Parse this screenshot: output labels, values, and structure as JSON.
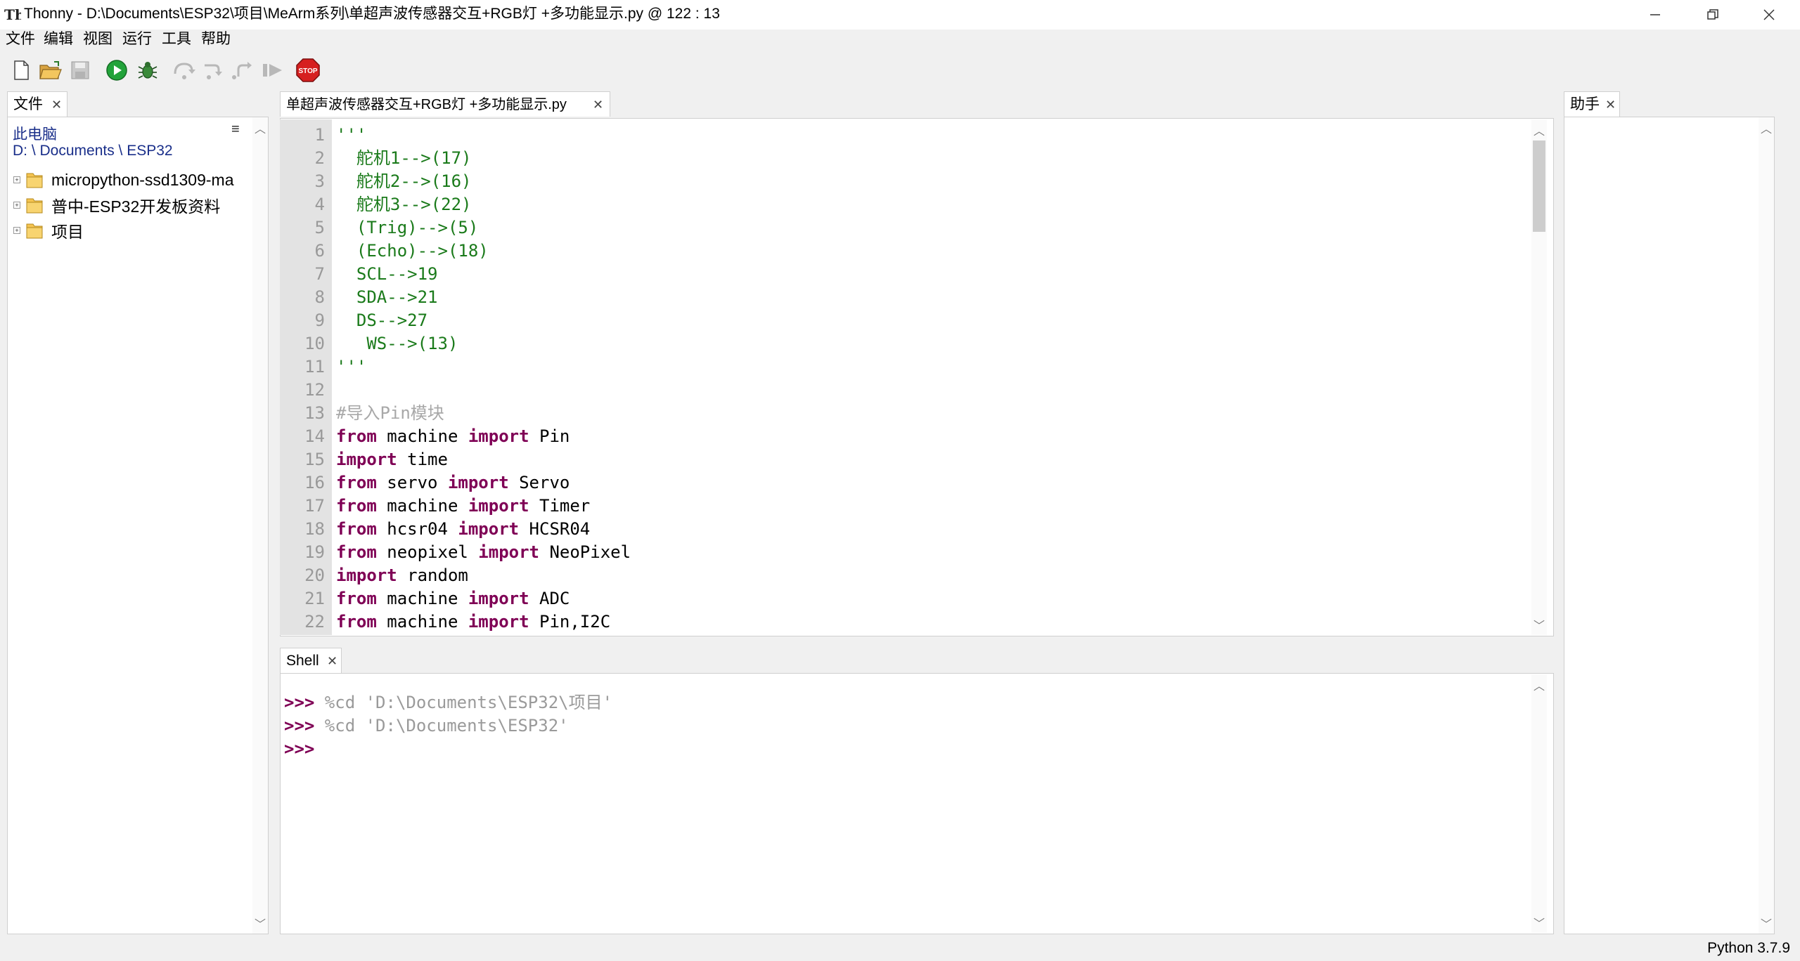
{
  "window": {
    "app_name": "Thonny",
    "title": "Thonny  -  D:\\Documents\\ESP32\\项目\\MeArm系列\\单超声波传感器交互+RGB灯 +多功能显示.py  @  122 : 13"
  },
  "menu": [
    "文件",
    "编辑",
    "视图",
    "运行",
    "工具",
    "帮助"
  ],
  "files_panel": {
    "tab": "文件",
    "location_label": "此电脑",
    "path": "D: \\ Documents \\ ESP32",
    "menu_glyph": "≡",
    "items": [
      {
        "label": "micropython-ssd1309-ma"
      },
      {
        "label": "普中-ESP32开发板资料"
      },
      {
        "label": "项目"
      }
    ]
  },
  "editor": {
    "tab": "单超声波传感器交互+RGB灯 +多功能显示.py",
    "lines": [
      {
        "n": "1",
        "parts": [
          {
            "t": "'''",
            "c": "str"
          }
        ]
      },
      {
        "n": "2",
        "parts": [
          {
            "t": "  舵机1-->(17)",
            "c": "str"
          }
        ]
      },
      {
        "n": "3",
        "parts": [
          {
            "t": "  舵机2-->(16)",
            "c": "str"
          }
        ]
      },
      {
        "n": "4",
        "parts": [
          {
            "t": "  舵机3-->(22)",
            "c": "str"
          }
        ]
      },
      {
        "n": "5",
        "parts": [
          {
            "t": "  (Trig)-->(5)",
            "c": "str"
          }
        ]
      },
      {
        "n": "6",
        "parts": [
          {
            "t": "  (Echo)-->(18)",
            "c": "str"
          }
        ]
      },
      {
        "n": "7",
        "parts": [
          {
            "t": "  SCL-->19",
            "c": "str"
          }
        ]
      },
      {
        "n": "8",
        "parts": [
          {
            "t": "  SDA-->21",
            "c": "str"
          }
        ]
      },
      {
        "n": "9",
        "parts": [
          {
            "t": "  DS-->27",
            "c": "str"
          }
        ]
      },
      {
        "n": "10",
        "parts": [
          {
            "t": "   WS-->(13)",
            "c": "str"
          }
        ]
      },
      {
        "n": "11",
        "parts": [
          {
            "t": "'''",
            "c": "str"
          }
        ]
      },
      {
        "n": "12",
        "parts": []
      },
      {
        "n": "13",
        "parts": [
          {
            "t": "#导入Pin模块",
            "c": "cmt"
          }
        ]
      },
      {
        "n": "14",
        "parts": [
          {
            "t": "from",
            "c": "kw"
          },
          {
            "t": " machine ",
            "c": ""
          },
          {
            "t": "import",
            "c": "kw"
          },
          {
            "t": " Pin",
            "c": ""
          }
        ]
      },
      {
        "n": "15",
        "parts": [
          {
            "t": "import",
            "c": "kw"
          },
          {
            "t": " time",
            "c": ""
          }
        ]
      },
      {
        "n": "16",
        "parts": [
          {
            "t": "from",
            "c": "kw"
          },
          {
            "t": " servo ",
            "c": ""
          },
          {
            "t": "import",
            "c": "kw"
          },
          {
            "t": " Servo",
            "c": ""
          }
        ]
      },
      {
        "n": "17",
        "parts": [
          {
            "t": "from",
            "c": "kw"
          },
          {
            "t": " machine ",
            "c": ""
          },
          {
            "t": "import",
            "c": "kw"
          },
          {
            "t": " Timer",
            "c": ""
          }
        ]
      },
      {
        "n": "18",
        "parts": [
          {
            "t": "from",
            "c": "kw"
          },
          {
            "t": " hcsr04 ",
            "c": ""
          },
          {
            "t": "import",
            "c": "kw"
          },
          {
            "t": " HCSR04",
            "c": ""
          }
        ]
      },
      {
        "n": "19",
        "parts": [
          {
            "t": "from",
            "c": "kw"
          },
          {
            "t": " neopixel ",
            "c": ""
          },
          {
            "t": "import",
            "c": "kw"
          },
          {
            "t": " NeoPixel",
            "c": ""
          }
        ]
      },
      {
        "n": "20",
        "parts": [
          {
            "t": "import",
            "c": "kw"
          },
          {
            "t": " random",
            "c": ""
          }
        ]
      },
      {
        "n": "21",
        "parts": [
          {
            "t": "from",
            "c": "kw"
          },
          {
            "t": " machine ",
            "c": ""
          },
          {
            "t": "import",
            "c": "kw"
          },
          {
            "t": " ADC",
            "c": ""
          }
        ]
      },
      {
        "n": "22",
        "parts": [
          {
            "t": "from",
            "c": "kw"
          },
          {
            "t": " machine ",
            "c": ""
          },
          {
            "t": "import",
            "c": "kw"
          },
          {
            "t": " Pin,I2C",
            "c": ""
          }
        ]
      }
    ]
  },
  "shell": {
    "tab": "Shell",
    "lines": [
      {
        "prompt": ">>>",
        "cmd": " %cd 'D:\\Documents\\ESP32\\项目'"
      },
      {
        "prompt": ">>>",
        "cmd": " %cd 'D:\\Documents\\ESP32'"
      },
      {
        "prompt": ">>>",
        "cmd": ""
      }
    ]
  },
  "assistant_panel": {
    "tab": "助手"
  },
  "status": {
    "interpreter": "Python 3.7.9"
  },
  "colors": {
    "keyword": "#7f0055",
    "string": "#1a7a1a",
    "comment": "#a8a8a8",
    "link": "#1a2f8a",
    "run_green": "#22a33a",
    "stop_red": "#d62020"
  },
  "icons": {
    "toolbar": [
      "new-file-icon",
      "open-folder-icon",
      "save-icon",
      "run-icon",
      "debug-icon",
      "step-over-icon",
      "step-into-icon",
      "step-out-icon",
      "resume-icon",
      "stop-icon"
    ]
  }
}
